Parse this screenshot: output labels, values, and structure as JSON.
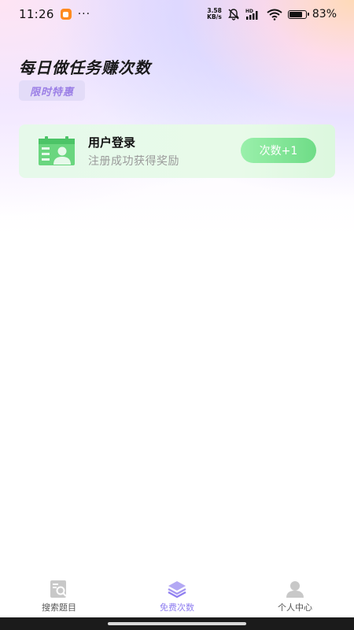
{
  "status_bar": {
    "time": "11:26",
    "more": "···",
    "net_speed_value": "3.58",
    "net_speed_unit": "KB/s",
    "battery": "83%"
  },
  "header": {
    "title": "每日做任务赚次数",
    "badge": "限时特惠"
  },
  "tasks": [
    {
      "title": "用户登录",
      "description": "注册成功获得奖励",
      "button": "次数+1",
      "icon": "user-login-icon"
    }
  ],
  "tab_bar": {
    "tabs": [
      {
        "label": "搜索题目",
        "icon": "search-question-icon",
        "active": false
      },
      {
        "label": "免费次数",
        "icon": "layers-icon",
        "active": true
      },
      {
        "label": "个人中心",
        "icon": "person-icon",
        "active": false
      }
    ]
  },
  "colors": {
    "accent_purple": "#8f7ef0",
    "accent_green": "#6fdc87",
    "card_bg": "#e6f9ea"
  }
}
